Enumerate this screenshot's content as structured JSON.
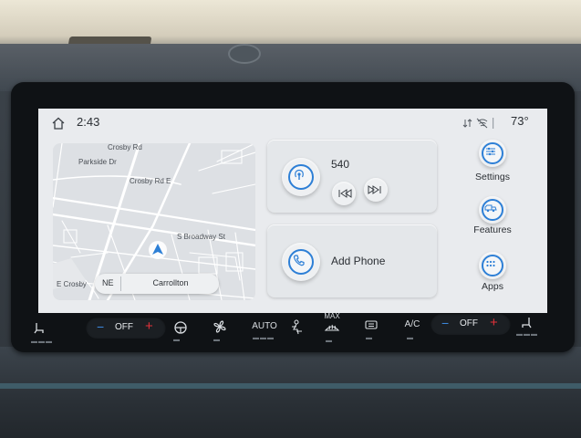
{
  "status": {
    "time": "2:43",
    "temperature": "73°"
  },
  "map": {
    "streets": [
      "Parkside Dr",
      "Crosby Rd E",
      "S Broadway St",
      "E Crosby",
      "Crosby Rd"
    ],
    "heading": "NE",
    "city": "Carrollton"
  },
  "media": {
    "station": "540",
    "phone_label": "Add Phone"
  },
  "side_menu": {
    "settings": "Settings",
    "features": "Features",
    "apps": "Apps"
  },
  "climate": {
    "left_fan": "OFF",
    "right_fan": "OFF",
    "auto": "AUTO",
    "max": "MAX",
    "ac": "A/C",
    "minus": "−",
    "plus": "+"
  },
  "colors": {
    "accent": "#2d7fd6",
    "screen_bg": "#e9ebee",
    "plus_red": "#e0313a"
  }
}
